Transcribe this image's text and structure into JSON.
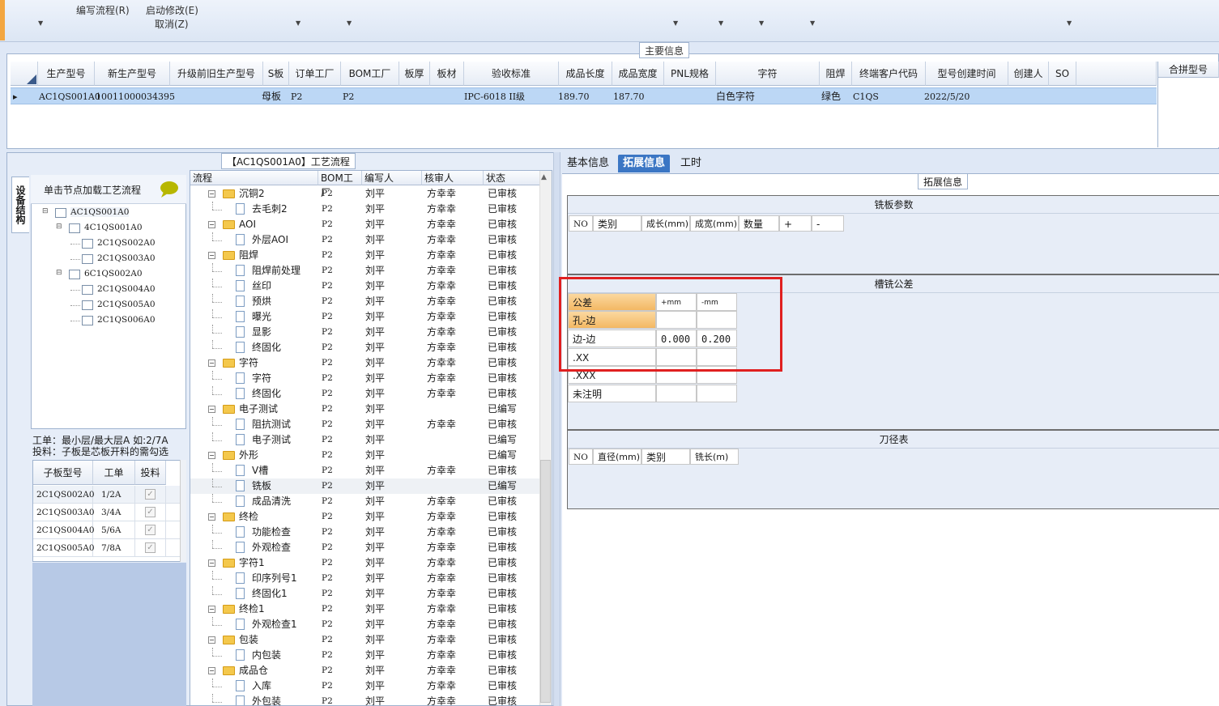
{
  "toolbar": {
    "items": [
      "编写流程(R)",
      "启动修改(E)",
      "取消(Z)"
    ]
  },
  "main_info": {
    "tab_label": "主要信息",
    "columns": [
      "生产型号",
      "新生产型号",
      "升级前旧生产型号",
      "S板",
      "订单工厂",
      "BOM工厂",
      "板厚",
      "板材",
      "验收标准",
      "成品长度",
      "成品宽度",
      "PNL规格",
      "字符",
      "阻焊",
      "终端客户代码",
      "型号创建时间",
      "创建人",
      "SO"
    ],
    "side_header": "合拼型号",
    "row": {
      "arrow": "▸",
      "model": "AC1QS001A0",
      "new_model": "10011000034395",
      "s_board": "母板",
      "order_factory": "P2",
      "bom_factory": "P2",
      "standard": "IPC-6018 II级",
      "length": "189.70",
      "width": "187.70",
      "char": "白色字符",
      "solder": "绿色",
      "customer": "C1QS",
      "created": "2022/5/20"
    }
  },
  "flow": {
    "title": "【AC1QS001A0】工艺流程",
    "vtab": "设备结构",
    "tree_hint": "单击节点加载工艺流程",
    "tree": [
      {
        "label": "AC1QS001A0",
        "level": 0
      },
      {
        "label": "4C1QS001A0",
        "level": 1
      },
      {
        "label": "2C1QS002A0",
        "level": 2
      },
      {
        "label": "2C1QS003A0",
        "level": 2
      },
      {
        "label": "6C1QS002A0",
        "level": 1
      },
      {
        "label": "2C1QS004A0",
        "level": 2
      },
      {
        "label": "2C1QS005A0",
        "level": 2
      },
      {
        "label": "2C1QS006A0",
        "level": 2
      }
    ],
    "info_line1": "工单：最小层/最大层A 如:2/7A",
    "info_line2": "投料：子板是芯板开料的需勾选",
    "sub_columns": [
      "子板型号",
      "工单",
      "投料"
    ],
    "sub_rows": [
      {
        "model": "2C1QS002A0",
        "order": "1/2A"
      },
      {
        "model": "2C1QS003A0",
        "order": "3/4A"
      },
      {
        "model": "2C1QS004A0",
        "order": "5/6A"
      },
      {
        "model": "2C1QS005A0",
        "order": "7/8A"
      }
    ]
  },
  "process_list": {
    "columns": [
      "流程",
      "BOM工厂",
      "编写人",
      "核审人",
      "状态"
    ],
    "rows": [
      {
        "name": "沉铜2",
        "type": "folder",
        "bom": "P2",
        "writer": "刘平",
        "reviewer": "方幸幸",
        "status": "已审核"
      },
      {
        "name": "去毛刺2",
        "type": "doc",
        "bom": "P2",
        "writer": "刘平",
        "reviewer": "方幸幸",
        "status": "已审核"
      },
      {
        "name": "AOI",
        "type": "folder",
        "bom": "P2",
        "writer": "刘平",
        "reviewer": "方幸幸",
        "status": "已审核"
      },
      {
        "name": "外层AOI",
        "type": "doc",
        "bom": "P2",
        "writer": "刘平",
        "reviewer": "方幸幸",
        "status": "已审核"
      },
      {
        "name": "阻焊",
        "type": "folder",
        "bom": "P2",
        "writer": "刘平",
        "reviewer": "方幸幸",
        "status": "已审核"
      },
      {
        "name": "阻焊前处理",
        "type": "doc",
        "bom": "P2",
        "writer": "刘平",
        "reviewer": "方幸幸",
        "status": "已审核"
      },
      {
        "name": "丝印",
        "type": "doc",
        "bom": "P2",
        "writer": "刘平",
        "reviewer": "方幸幸",
        "status": "已审核"
      },
      {
        "name": "预烘",
        "type": "doc",
        "bom": "P2",
        "writer": "刘平",
        "reviewer": "方幸幸",
        "status": "已审核"
      },
      {
        "name": "曝光",
        "type": "doc",
        "bom": "P2",
        "writer": "刘平",
        "reviewer": "方幸幸",
        "status": "已审核"
      },
      {
        "name": "显影",
        "type": "doc",
        "bom": "P2",
        "writer": "刘平",
        "reviewer": "方幸幸",
        "status": "已审核"
      },
      {
        "name": "终固化",
        "type": "doc",
        "bom": "P2",
        "writer": "刘平",
        "reviewer": "方幸幸",
        "status": "已审核"
      },
      {
        "name": "字符",
        "type": "folder",
        "bom": "P2",
        "writer": "刘平",
        "reviewer": "方幸幸",
        "status": "已审核"
      },
      {
        "name": "字符",
        "type": "doc",
        "bom": "P2",
        "writer": "刘平",
        "reviewer": "方幸幸",
        "status": "已审核"
      },
      {
        "name": "终固化",
        "type": "doc",
        "bom": "P2",
        "writer": "刘平",
        "reviewer": "方幸幸",
        "status": "已审核"
      },
      {
        "name": "电子测试",
        "type": "folder",
        "bom": "P2",
        "writer": "刘平",
        "reviewer": "",
        "status": "已编写"
      },
      {
        "name": "阻抗测试",
        "type": "doc",
        "bom": "P2",
        "writer": "刘平",
        "reviewer": "方幸幸",
        "status": "已审核"
      },
      {
        "name": "电子测试",
        "type": "doc",
        "bom": "P2",
        "writer": "刘平",
        "reviewer": "",
        "status": "已编写"
      },
      {
        "name": "外形",
        "type": "folder",
        "bom": "P2",
        "writer": "刘平",
        "reviewer": "",
        "status": "已编写"
      },
      {
        "name": "V槽",
        "type": "doc",
        "bom": "P2",
        "writer": "刘平",
        "reviewer": "方幸幸",
        "status": "已审核"
      },
      {
        "name": "铣板",
        "type": "doc",
        "bom": "P2",
        "writer": "刘平",
        "reviewer": "",
        "status": "已编写",
        "selected": true
      },
      {
        "name": "成品清洗",
        "type": "doc",
        "bom": "P2",
        "writer": "刘平",
        "reviewer": "方幸幸",
        "status": "已审核"
      },
      {
        "name": "终检",
        "type": "folder",
        "bom": "P2",
        "writer": "刘平",
        "reviewer": "方幸幸",
        "status": "已审核"
      },
      {
        "name": "功能检查",
        "type": "doc",
        "bom": "P2",
        "writer": "刘平",
        "reviewer": "方幸幸",
        "status": "已审核"
      },
      {
        "name": "外观检查",
        "type": "doc",
        "bom": "P2",
        "writer": "刘平",
        "reviewer": "方幸幸",
        "status": "已审核"
      },
      {
        "name": "字符1",
        "type": "folder",
        "bom": "P2",
        "writer": "刘平",
        "reviewer": "方幸幸",
        "status": "已审核"
      },
      {
        "name": "印序列号1",
        "type": "doc",
        "bom": "P2",
        "writer": "刘平",
        "reviewer": "方幸幸",
        "status": "已审核"
      },
      {
        "name": "终固化1",
        "type": "doc",
        "bom": "P2",
        "writer": "刘平",
        "reviewer": "方幸幸",
        "status": "已审核"
      },
      {
        "name": "终检1",
        "type": "folder",
        "bom": "P2",
        "writer": "刘平",
        "reviewer": "方幸幸",
        "status": "已审核"
      },
      {
        "name": "外观检查1",
        "type": "doc",
        "bom": "P2",
        "writer": "刘平",
        "reviewer": "方幸幸",
        "status": "已审核"
      },
      {
        "name": "包装",
        "type": "folder",
        "bom": "P2",
        "writer": "刘平",
        "reviewer": "方幸幸",
        "status": "已审核"
      },
      {
        "name": "内包装",
        "type": "doc",
        "bom": "P2",
        "writer": "刘平",
        "reviewer": "方幸幸",
        "status": "已审核"
      },
      {
        "name": "成品仓",
        "type": "folder",
        "bom": "P2",
        "writer": "刘平",
        "reviewer": "方幸幸",
        "status": "已审核"
      },
      {
        "name": "入库",
        "type": "doc",
        "bom": "P2",
        "writer": "刘平",
        "reviewer": "方幸幸",
        "status": "已审核"
      },
      {
        "name": "外包装",
        "type": "doc",
        "bom": "P2",
        "writer": "刘平",
        "reviewer": "方幸幸",
        "status": "已审核"
      }
    ]
  },
  "right": {
    "tabs": [
      "基本信息",
      "拓展信息",
      "工时"
    ],
    "active_tab": "拓展信息",
    "ext_title": "拓展信息",
    "mill_params": {
      "title": "铣板参数",
      "columns": [
        "NO",
        "类别",
        "成长(mm)",
        "成宽(mm)",
        "数量",
        "+",
        "-"
      ]
    },
    "tolerance": {
      "title": "槽铣公差",
      "header": [
        "公差",
        "+mm",
        "-mm"
      ],
      "rows": [
        {
          "label": "孔-边",
          "plus": "",
          "minus": ""
        },
        {
          "label": "边-边",
          "plus": "0.000",
          "minus": "0.200"
        },
        {
          "label": ".XX",
          "plus": "",
          "minus": ""
        },
        {
          "label": ".XXX",
          "plus": "",
          "minus": ""
        },
        {
          "label": "未注明",
          "plus": "",
          "minus": ""
        }
      ]
    },
    "tool_table": {
      "title": "刀径表",
      "columns": [
        "NO",
        "直径(mm)",
        "类别",
        "铣长(m)"
      ]
    }
  },
  "colors": {
    "accent": "#3b76c4",
    "highlight": "#e02020",
    "row_selected": "#bcd7f5",
    "folder": "#f4c84c"
  }
}
